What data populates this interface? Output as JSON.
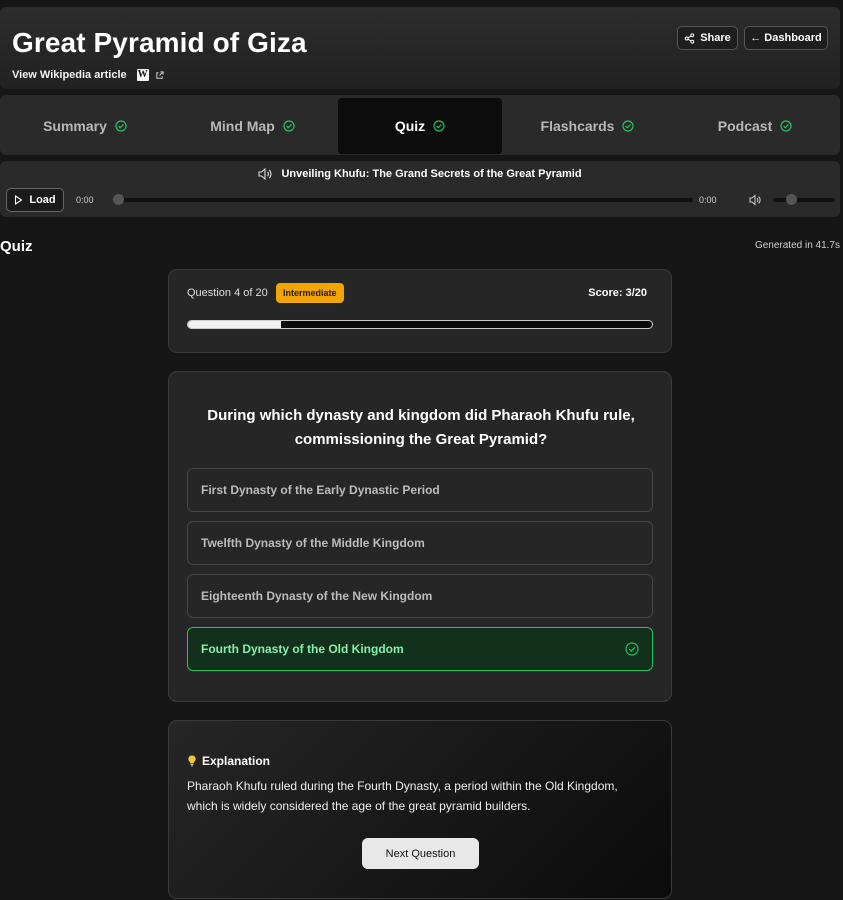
{
  "header": {
    "title": "Great Pyramid of Giza",
    "wiki_link": "View Wikipedia article",
    "wiki_badge": "W",
    "share_label": "Share",
    "dashboard_label": "← Dashboard"
  },
  "tabs": [
    {
      "label": "Summary",
      "done": true
    },
    {
      "label": "Mind Map",
      "done": true
    },
    {
      "label": "Quiz",
      "done": true,
      "active": true
    },
    {
      "label": "Flashcards",
      "done": true
    },
    {
      "label": "Podcast",
      "done": true
    }
  ],
  "player": {
    "track_title": "Unveiling Khufu: The Grand Secrets of the Great Pyramid",
    "load_label": "Load",
    "current_time": "0:00",
    "duration": "0:00",
    "progress": 0,
    "volume": 0.25
  },
  "section": {
    "title": "Quiz",
    "generated": "Generated in 41.7s"
  },
  "quiz": {
    "question_counter": "Question 4 of 20",
    "level": "Intermediate",
    "score": "Score: 3/20",
    "progress": 0.2,
    "question": "During which dynasty and kingdom did Pharaoh Khufu rule, commissioning the Great Pyramid?",
    "options": [
      {
        "text": "First Dynasty of the Early Dynastic Period",
        "correct": false
      },
      {
        "text": "Twelfth Dynasty of the Middle Kingdom",
        "correct": false
      },
      {
        "text": "Eighteenth Dynasty of the New Kingdom",
        "correct": false
      },
      {
        "text": "Fourth Dynasty of the Old Kingdom",
        "correct": true
      }
    ]
  },
  "explanation": {
    "heading": "Explanation",
    "text": "Pharaoh Khufu ruled during the Fourth Dynasty, a period within the Old Kingdom, which is widely considered the age of the great pyramid builders.",
    "next_label": "Next Question"
  },
  "colors": {
    "accent_green": "#22c55e",
    "level_badge": "#f0a500"
  }
}
